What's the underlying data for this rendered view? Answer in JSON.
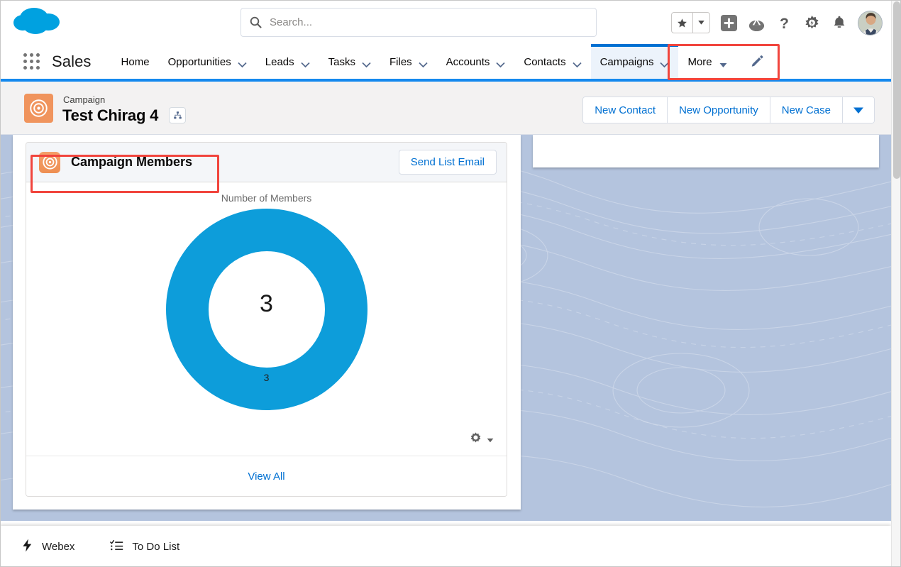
{
  "header": {
    "logo_icon": "salesforce-cloud-logo",
    "search": {
      "placeholder": "Search...",
      "value": "",
      "icon": "search-icon"
    },
    "icons": [
      {
        "name": "favorites-star-icon",
        "glyph": "★"
      },
      {
        "name": "favorites-dropdown-icon",
        "glyph": "▾"
      },
      {
        "name": "global-add-icon",
        "glyph": "+"
      },
      {
        "name": "trailhead-icon",
        "glyph": "▲"
      },
      {
        "name": "help-icon",
        "glyph": "?"
      },
      {
        "name": "setup-gear-icon",
        "glyph": "⚙"
      },
      {
        "name": "notifications-bell-icon",
        "glyph": "🔔"
      },
      {
        "name": "user-avatar",
        "glyph": ""
      }
    ]
  },
  "nav": {
    "app_launcher_label": "app-launcher-waffle",
    "app_name": "Sales",
    "items": [
      {
        "label": "Home",
        "has_dropdown": false,
        "active": false
      },
      {
        "label": "Opportunities",
        "has_dropdown": true,
        "active": false
      },
      {
        "label": "Leads",
        "has_dropdown": true,
        "active": false
      },
      {
        "label": "Tasks",
        "has_dropdown": true,
        "active": false
      },
      {
        "label": "Files",
        "has_dropdown": true,
        "active": false
      },
      {
        "label": "Accounts",
        "has_dropdown": true,
        "active": false
      },
      {
        "label": "Contacts",
        "has_dropdown": true,
        "active": false
      },
      {
        "label": "Campaigns",
        "has_dropdown": true,
        "active": true
      },
      {
        "label": "More",
        "has_dropdown": true,
        "active": false
      }
    ],
    "edit_icon": "pencil-icon"
  },
  "record": {
    "object_label": "Campaign",
    "title": "Test Chirag 4",
    "icon": "campaign-target-icon",
    "hierarchy_icon": "hierarchy-icon",
    "actions": [
      {
        "label": "New Contact"
      },
      {
        "label": "New Opportunity"
      },
      {
        "label": "New Case"
      }
    ],
    "actions_more_icon": "caret-down-icon"
  },
  "campaign_members_card": {
    "icon": "campaign-members-target-icon",
    "title": "Campaign Members",
    "send_email_label": "Send List Email",
    "view_all_label": "View All",
    "chart_settings_icon": "gear-icon",
    "chart_settings_caret": "caret-down-icon"
  },
  "utility_bar": {
    "items": [
      {
        "label": "Webex",
        "icon": "lightning-bolt-icon"
      },
      {
        "label": "To Do List",
        "icon": "checklist-icon"
      }
    ]
  },
  "annotations": [
    {
      "name": "campaigns-tab-highlight",
      "color": "#f1453d"
    },
    {
      "name": "campaign-members-header-highlight",
      "color": "#f1453d"
    }
  ],
  "colors": {
    "brand_blue": "#1589ee",
    "link_blue": "#0070d2",
    "donut_blue": "#0d9dda",
    "campaign_orange": "#f0945d",
    "annotation_red": "#f1453d",
    "page_background": "#b4c4de",
    "header_grey": "#f3f2f2"
  },
  "chart_data": {
    "type": "pie",
    "variant": "donut",
    "title": "Number of Members",
    "categories": [
      "Members"
    ],
    "values": [
      3
    ],
    "total": 3,
    "center_label": "3",
    "data_labels": [
      "3"
    ],
    "colors": [
      "#0d9dda"
    ],
    "legend": false,
    "grid": false,
    "xlabel": "",
    "ylabel": ""
  }
}
